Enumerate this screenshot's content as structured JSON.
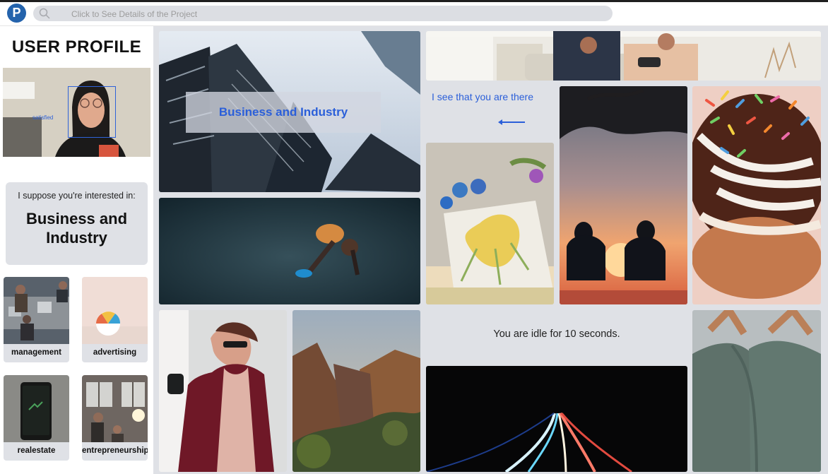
{
  "topbar": {
    "logo_letter": "P",
    "search_placeholder": "Click to See Details of the Project"
  },
  "sidebar": {
    "title": "USER PROFILE",
    "webcam_emotion": "satisfied",
    "interest_intro": "I suppose you're interested in:",
    "interest_topic": "Business and Industry",
    "categories": [
      {
        "label": "management"
      },
      {
        "label": "advertising"
      },
      {
        "label": "realestate"
      },
      {
        "label": "entrepreneurship"
      }
    ]
  },
  "main": {
    "hero_label": "Business and Industry",
    "presence_message": "I see that you are there",
    "idle_message": "You are idle for 10 seconds."
  },
  "colors": {
    "accent_blue": "#2b5fd9",
    "panel_bg": "#dfe1e6",
    "logo_blue": "#2463ac"
  }
}
